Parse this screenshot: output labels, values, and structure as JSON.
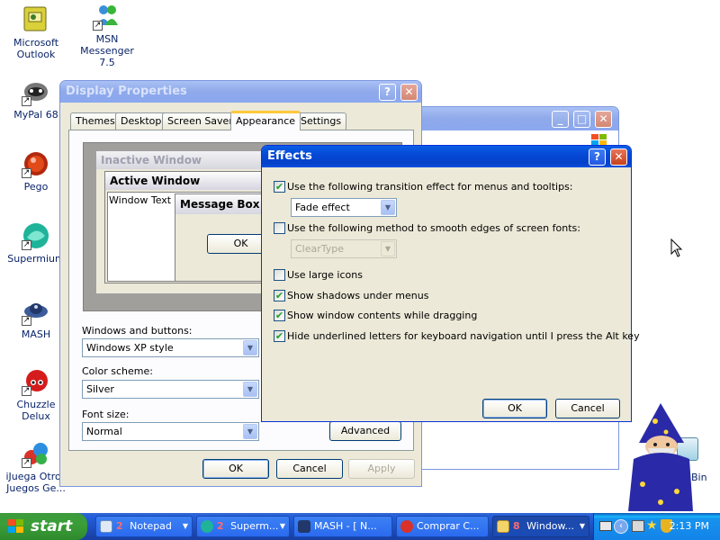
{
  "desktop": {
    "icons": [
      {
        "label": "Microsoft\nOutlook",
        "icon": "outlook-icon"
      },
      {
        "label": "MSN Messenger\n7.5",
        "icon": "msn-messenger-icon"
      },
      {
        "label": "MyPal 68",
        "icon": "mypal-icon"
      },
      {
        "label": "Pego",
        "icon": "pego-icon"
      },
      {
        "label": "Supermium",
        "icon": "supermium-icon"
      },
      {
        "label": "MASH",
        "icon": "mash-icon"
      },
      {
        "label": "Chuzzle Delux",
        "icon": "chuzzle-icon"
      },
      {
        "label": "iJuega Otros\nJuegos Ge...",
        "icon": "games-icon"
      },
      {
        "label": "Bin",
        "icon": "recycle-bin-icon"
      }
    ]
  },
  "display_properties": {
    "title": "Display Properties",
    "tabs": [
      "Themes",
      "Desktop",
      "Screen Saver",
      "Appearance",
      "Settings"
    ],
    "selected_tab": "Appearance",
    "preview": {
      "inactive_title": "Inactive Window",
      "active_title": "Active Window",
      "window_text": "Window Text",
      "message_box_title": "Message Box",
      "message_box_ok": "OK"
    },
    "windows_and_buttons_label": "Windows and buttons:",
    "windows_and_buttons_value": "Windows XP style",
    "color_scheme_label": "Color scheme:",
    "color_scheme_value": "Silver",
    "font_size_label": "Font size:",
    "font_size_value": "Normal",
    "advanced_label": "Advanced",
    "ok_label": "OK",
    "cancel_label": "Cancel",
    "apply_label": "Apply"
  },
  "effects": {
    "title": "Effects",
    "options": [
      {
        "label": "Use the following transition effect for menus and tooltips:",
        "checked": true
      },
      {
        "label": "Use the following method to smooth edges of screen fonts:",
        "checked": false
      },
      {
        "label": "Use large icons",
        "checked": false
      },
      {
        "label": "Show shadows under menus",
        "checked": true
      },
      {
        "label": "Show window contents while dragging",
        "checked": true
      },
      {
        "label": "Hide underlined letters for keyboard navigation until I press the Alt key",
        "checked": true
      }
    ],
    "transition_value": "Fade effect",
    "smoothing_value": "ClearType",
    "ok_label": "OK",
    "cancel_label": "Cancel"
  },
  "taskbar": {
    "start_label": "start",
    "tasks": [
      {
        "count": "2",
        "label": "Notepad",
        "icon": "notepad-icon"
      },
      {
        "count": "2",
        "label": "Superm...",
        "icon": "supermium-icon"
      },
      {
        "count": "",
        "label": "MASH - [ N...",
        "icon": "mash-icon"
      },
      {
        "count": "",
        "label": "Comprar C...",
        "icon": "browser-icon"
      },
      {
        "count": "8",
        "label": "Window...",
        "icon": "folder-icon"
      }
    ],
    "clock": "2:13 PM"
  }
}
